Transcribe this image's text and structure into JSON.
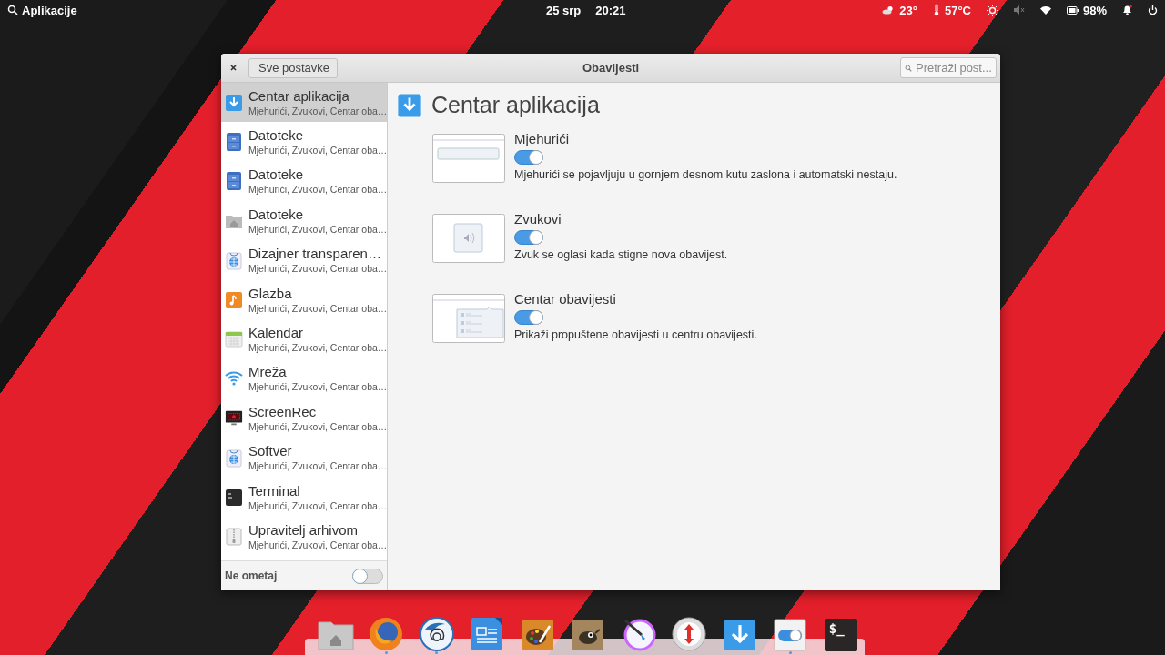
{
  "panel": {
    "applications": "Aplikacije",
    "date": "25 srp",
    "time": "20:21",
    "weather": "23°",
    "temperature": "57°C",
    "battery": "98%"
  },
  "window": {
    "title": "Obavijesti",
    "back": "Sve postavke",
    "search": {
      "placeholder": "Pretraži post..."
    }
  },
  "sidebar": {
    "items": [
      {
        "name": "Centar aplikacija",
        "subtitle": "Mjehurići, Zvukovi, Centar oba…",
        "kind": "download",
        "selected": true
      },
      {
        "name": "Datoteke",
        "subtitle": "Mjehurići, Zvukovi, Centar oba…",
        "kind": "cabinet",
        "selected": false
      },
      {
        "name": "Datoteke",
        "subtitle": "Mjehurići, Zvukovi, Centar oba…",
        "kind": "cabinet",
        "selected": false
      },
      {
        "name": "Datoteke",
        "subtitle": "Mjehurići, Zvukovi, Centar oba…",
        "kind": "folder",
        "selected": false
      },
      {
        "name": "Dizajner transparen…",
        "subtitle": "Mjehurići, Zvukovi, Centar oba…",
        "kind": "globe",
        "selected": false
      },
      {
        "name": "Glazba",
        "subtitle": "Mjehurići, Zvukovi, Centar oba…",
        "kind": "music",
        "selected": false
      },
      {
        "name": "Kalendar",
        "subtitle": "Mjehurići, Zvukovi, Centar oba…",
        "kind": "calendar",
        "selected": false
      },
      {
        "name": "Mreža",
        "subtitle": "Mjehurići, Zvukovi, Centar oba…",
        "kind": "wifi",
        "selected": false
      },
      {
        "name": "ScreenRec",
        "subtitle": "Mjehurići, Zvukovi, Centar oba…",
        "kind": "monitor",
        "selected": false
      },
      {
        "name": "Softver",
        "subtitle": "Mjehurići, Zvukovi, Centar oba…",
        "kind": "globe",
        "selected": false
      },
      {
        "name": "Terminal",
        "subtitle": "Mjehurići, Zvukovi, Centar oba…",
        "kind": "terminal",
        "selected": false
      },
      {
        "name": "Upravitelj arhivom",
        "subtitle": "Mjehurići, Zvukovi, Centar oba…",
        "kind": "zip",
        "selected": false
      }
    ],
    "do_not_disturb": {
      "label": "Ne ometaj",
      "on": false
    }
  },
  "content": {
    "title": "Centar aplikacija",
    "settings": [
      {
        "kind": "bubbles",
        "label": "Mjehurići",
        "on": true,
        "description": "Mjehurići se pojavljuju u gornjem desnom kutu zaslona i automatski nestaju."
      },
      {
        "kind": "sounds",
        "label": "Zvukovi",
        "on": true,
        "description": "Zvuk se oglasi kada stigne nova obavijest."
      },
      {
        "kind": "center",
        "label": "Centar obavijesti",
        "on": true,
        "description": "Prikaži propuštene obavijesti u centru obavijesti."
      }
    ]
  },
  "dock": [
    {
      "kind": "folder",
      "running": false
    },
    {
      "kind": "firefox",
      "running": true
    },
    {
      "kind": "mail",
      "running": true
    },
    {
      "kind": "document",
      "running": false
    },
    {
      "kind": "palette",
      "running": false
    },
    {
      "kind": "gimp",
      "running": false
    },
    {
      "kind": "brush",
      "running": false
    },
    {
      "kind": "updown",
      "running": false
    },
    {
      "kind": "download",
      "running": false
    },
    {
      "kind": "switch",
      "running": true
    },
    {
      "kind": "terminal",
      "running": false,
      "text": "$_"
    }
  ]
}
